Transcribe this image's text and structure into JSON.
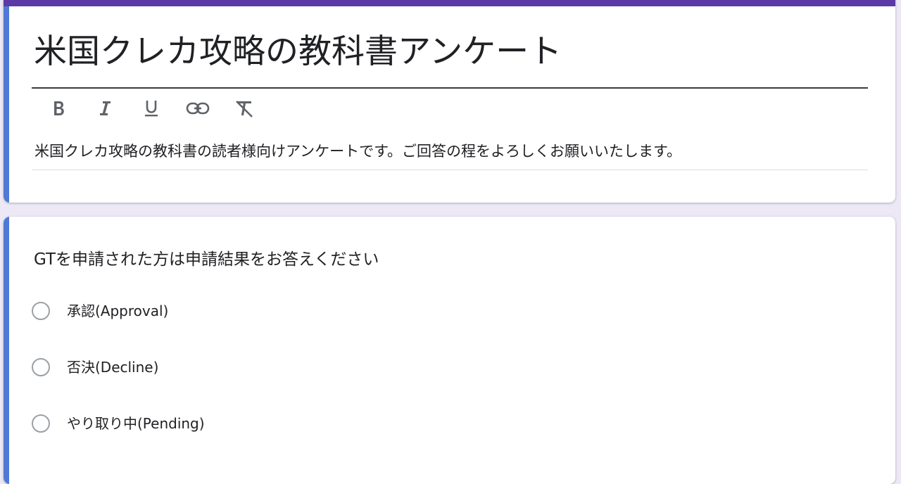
{
  "form": {
    "title": "米国クレカ攻略の教科書アンケート",
    "description": "米国クレカ攻略の教科書の読者様向けアンケートです。ご回答の程をよろしくお願いいたします。",
    "toolbar": [
      {
        "icon": "bold-icon"
      },
      {
        "icon": "italic-icon"
      },
      {
        "icon": "underline-icon"
      },
      {
        "icon": "link-icon"
      },
      {
        "icon": "clear-formatting-icon"
      }
    ]
  },
  "question": {
    "text": "GTを申請された方は申請結果をお答えください",
    "options": [
      {
        "label": "承認(Approval)",
        "selected": false
      },
      {
        "label": "否決(Decline)",
        "selected": false
      },
      {
        "label": "やり取り中(Pending)",
        "selected": false
      }
    ]
  },
  "colors": {
    "header_bar": "#5b3aa6",
    "active_accent": "#4f79d6",
    "background": "#ece8f5"
  }
}
